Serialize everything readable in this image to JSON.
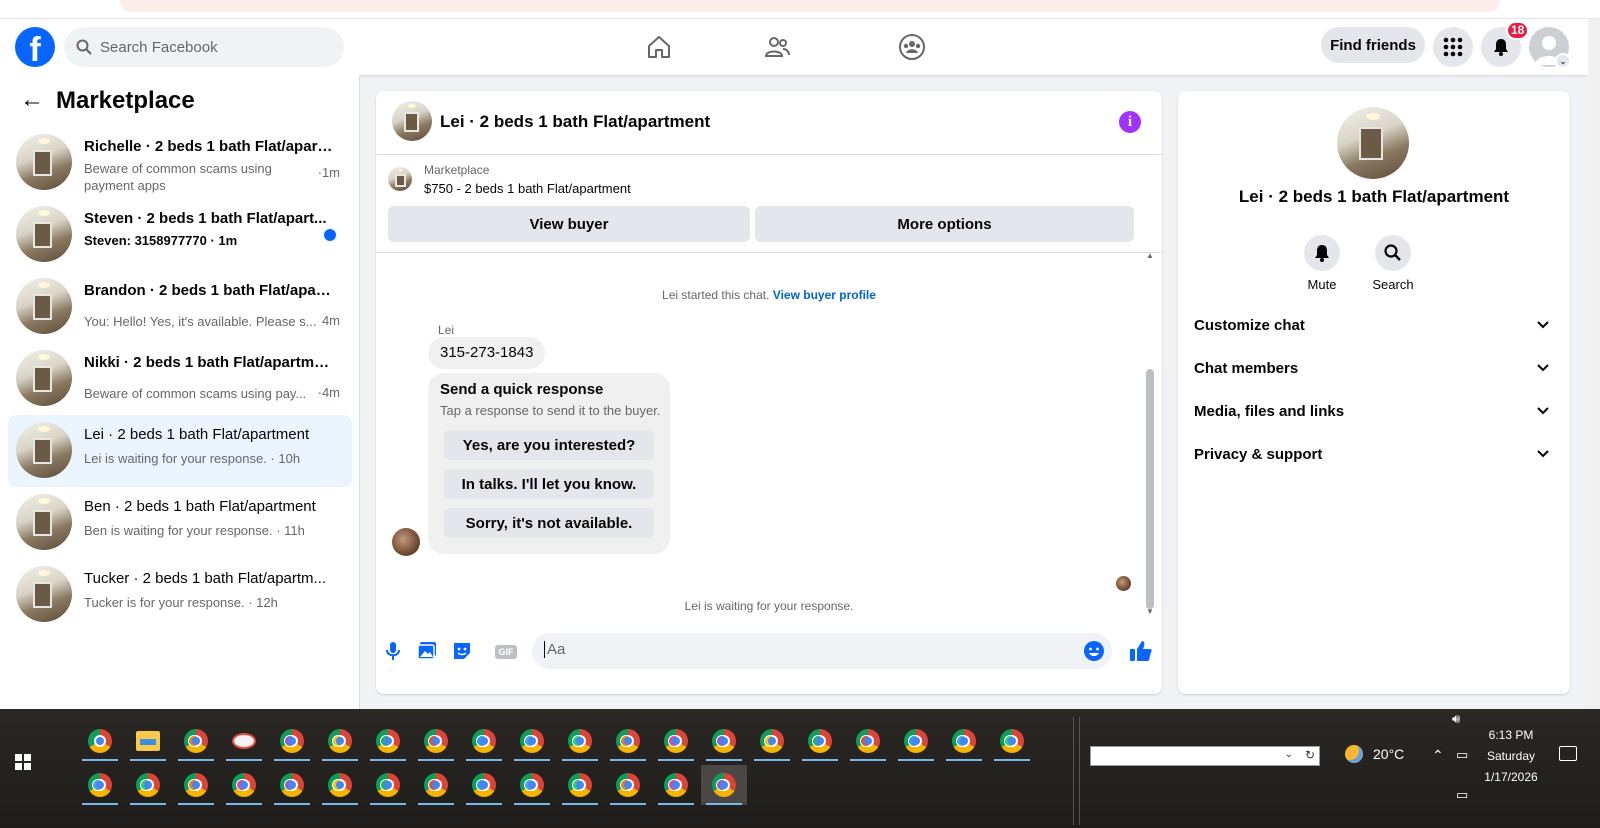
{
  "topnav": {
    "search_placeholder": "Search Facebook",
    "find_friends": "Find friends",
    "notification_count": "18"
  },
  "sidebar": {
    "title": "Marketplace",
    "conversations": [
      {
        "title": "Richelle · 2 beds 1 bath Flat/apart...",
        "subtitle": "Beware of common scams using payment apps",
        "time": "·1m",
        "unread": false,
        "active": false
      },
      {
        "title": "Steven · 2 beds 1 bath Flat/apart...",
        "subtitle": "Steven: 3158977770 · 1m",
        "time": "",
        "unread": true,
        "active": false
      },
      {
        "title": "Brandon · 2 beds 1 bath Flat/apart...",
        "subtitle": "You: Hello! Yes, it's available. Please s...",
        "time": "4m",
        "unread": false,
        "active": false
      },
      {
        "title": "Nikki · 2 beds 1 bath Flat/apartment",
        "subtitle": "Beware of common scams using pay...",
        "time": "·4m",
        "unread": false,
        "active": false
      },
      {
        "title": "Lei · 2 beds 1 bath Flat/apartment",
        "subtitle": "Lei is waiting for your response. · 10h",
        "time": "",
        "unread": false,
        "active": true
      },
      {
        "title": "Ben · 2 beds 1 bath Flat/apartment",
        "subtitle": "Ben is waiting for your response. · 11h",
        "time": "",
        "unread": false,
        "active": false
      },
      {
        "title": "Tucker · 2 beds 1 bath Flat/apartm...",
        "subtitle": "Tucker is for your response. · 12h",
        "time": "",
        "unread": false,
        "active": false
      }
    ]
  },
  "chat": {
    "title": "Lei · 2 beds 1 bath Flat/apartment",
    "listing_source": "Marketplace",
    "listing_price": "$750 - 2 beds 1 bath Flat/apartment",
    "view_buyer": "View buyer",
    "more_options": "More options",
    "started_text": "Lei started this chat.",
    "view_profile_link": "View buyer profile",
    "sender": "Lei",
    "phone_message": "315-273-1843",
    "quick_title": "Send a quick response",
    "quick_sub": "Tap a response to send it to the buyer.",
    "quick_replies": [
      "Yes, are you interested?",
      "In talks. I'll let you know.",
      "Sorry, it's not available."
    ],
    "waiting": "Lei is waiting for your response.",
    "composer_placeholder": "Aa",
    "gif_label": "GIF"
  },
  "right_panel": {
    "name": "Lei · 2 beds 1 bath Flat/apartment",
    "mute": "Mute",
    "search": "Search",
    "sections": [
      "Customize chat",
      "Chat members",
      "Media, files and links",
      "Privacy & support"
    ]
  },
  "taskbar": {
    "temperature": "20°C",
    "time": "6:13 PM",
    "day": "Saturday",
    "date": "1/17/2026"
  },
  "colors": {
    "brand": "#0866ff",
    "info": "#a033ff",
    "badge": "#e41e3f",
    "active_row": "#ebf5ff"
  }
}
